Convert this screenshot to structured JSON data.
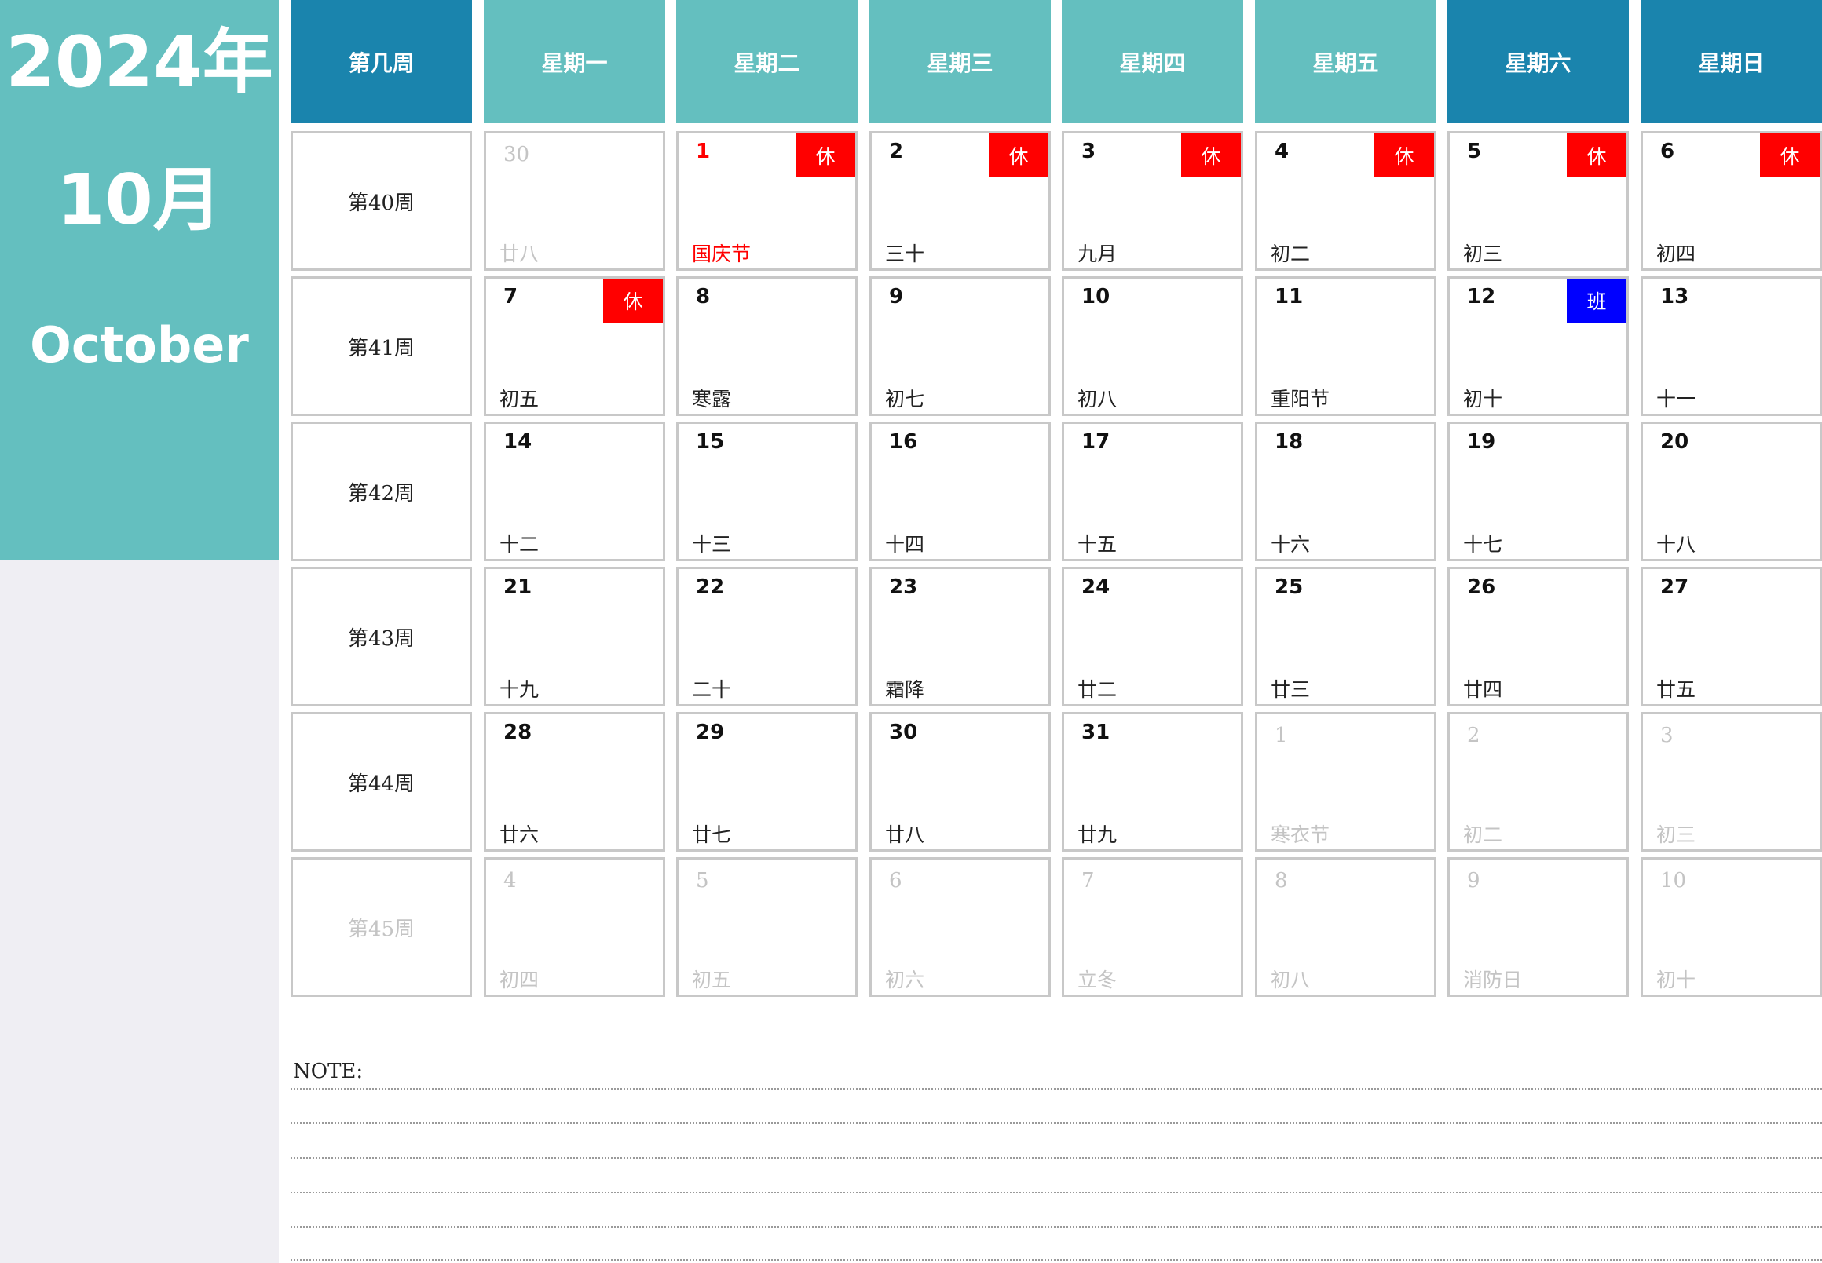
{
  "header": {
    "year": "2024年",
    "month": "10月",
    "month_en": "October"
  },
  "weekdays": [
    {
      "label": "第几周",
      "color": "#1a84ad"
    },
    {
      "label": "星期一",
      "color": "#64bfbf"
    },
    {
      "label": "星期二",
      "color": "#64bfbf"
    },
    {
      "label": "星期三",
      "color": "#64bfbf"
    },
    {
      "label": "星期四",
      "color": "#64bfbf"
    },
    {
      "label": "星期五",
      "color": "#64bfbf"
    },
    {
      "label": "星期六",
      "color": "#1a84ad"
    },
    {
      "label": "星期日",
      "color": "#1a84ad"
    }
  ],
  "weeks": [
    {
      "label": "第40周",
      "dim": false,
      "days": [
        {
          "num": "30",
          "lunar": "廿八",
          "dim": true
        },
        {
          "num": "1",
          "lunar": "国庆节",
          "red": true,
          "badge": "休",
          "badge_type": "rest"
        },
        {
          "num": "2",
          "lunar": "三十",
          "badge": "休",
          "badge_type": "rest"
        },
        {
          "num": "3",
          "lunar": "九月",
          "badge": "休",
          "badge_type": "rest"
        },
        {
          "num": "4",
          "lunar": "初二",
          "badge": "休",
          "badge_type": "rest"
        },
        {
          "num": "5",
          "lunar": "初三",
          "badge": "休",
          "badge_type": "rest"
        },
        {
          "num": "6",
          "lunar": "初四",
          "badge": "休",
          "badge_type": "rest"
        }
      ]
    },
    {
      "label": "第41周",
      "dim": false,
      "days": [
        {
          "num": "7",
          "lunar": "初五",
          "badge": "休",
          "badge_type": "rest"
        },
        {
          "num": "8",
          "lunar": "寒露"
        },
        {
          "num": "9",
          "lunar": "初七"
        },
        {
          "num": "10",
          "lunar": "初八"
        },
        {
          "num": "11",
          "lunar": "重阳节"
        },
        {
          "num": "12",
          "lunar": "初十",
          "badge": "班",
          "badge_type": "work"
        },
        {
          "num": "13",
          "lunar": "十一"
        }
      ]
    },
    {
      "label": "第42周",
      "dim": false,
      "days": [
        {
          "num": "14",
          "lunar": "十二"
        },
        {
          "num": "15",
          "lunar": "十三"
        },
        {
          "num": "16",
          "lunar": "十四"
        },
        {
          "num": "17",
          "lunar": "十五"
        },
        {
          "num": "18",
          "lunar": "十六"
        },
        {
          "num": "19",
          "lunar": "十七"
        },
        {
          "num": "20",
          "lunar": "十八"
        }
      ]
    },
    {
      "label": "第43周",
      "dim": false,
      "days": [
        {
          "num": "21",
          "lunar": "十九"
        },
        {
          "num": "22",
          "lunar": "二十"
        },
        {
          "num": "23",
          "lunar": "霜降"
        },
        {
          "num": "24",
          "lunar": "廿二"
        },
        {
          "num": "25",
          "lunar": "廿三"
        },
        {
          "num": "26",
          "lunar": "廿四"
        },
        {
          "num": "27",
          "lunar": "廿五"
        }
      ]
    },
    {
      "label": "第44周",
      "dim": false,
      "days": [
        {
          "num": "28",
          "lunar": "廿六"
        },
        {
          "num": "29",
          "lunar": "廿七"
        },
        {
          "num": "30",
          "lunar": "廿八"
        },
        {
          "num": "31",
          "lunar": "廿九"
        },
        {
          "num": "1",
          "lunar": "寒衣节",
          "dim": true
        },
        {
          "num": "2",
          "lunar": "初二",
          "dim": true
        },
        {
          "num": "3",
          "lunar": "初三",
          "dim": true
        }
      ]
    },
    {
      "label": "第45周",
      "dim": true,
      "days": [
        {
          "num": "4",
          "lunar": "初四",
          "dim": true
        },
        {
          "num": "5",
          "lunar": "初五",
          "dim": true
        },
        {
          "num": "6",
          "lunar": "初六",
          "dim": true
        },
        {
          "num": "7",
          "lunar": "立冬",
          "dim": true
        },
        {
          "num": "8",
          "lunar": "初八",
          "dim": true
        },
        {
          "num": "9",
          "lunar": "消防日",
          "dim": true
        },
        {
          "num": "10",
          "lunar": "初十",
          "dim": true
        }
      ]
    }
  ],
  "note": {
    "label": "NOTE:"
  }
}
